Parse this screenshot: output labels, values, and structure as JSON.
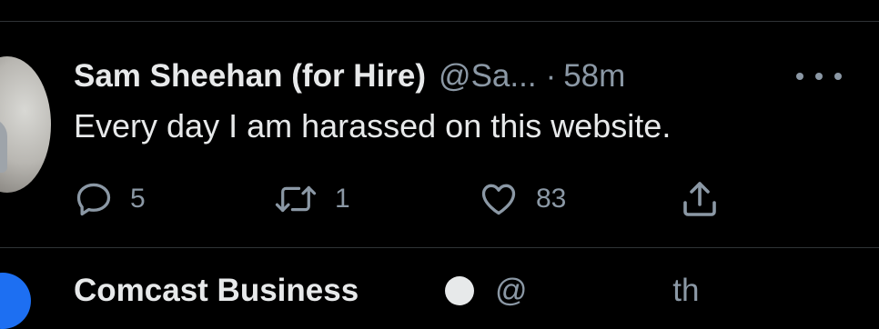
{
  "tweet": {
    "author_name": "Sam Sheehan (for Hire)",
    "author_handle": "@Sa...",
    "separator": "·",
    "time": "58m",
    "text": "Every day I am harassed on this website.",
    "actions": {
      "reply_count": "5",
      "retweet_count": "1",
      "like_count": "83"
    },
    "icons": {
      "reply": "reply-icon",
      "retweet": "retweet-icon",
      "like": "heart-icon",
      "share": "share-icon",
      "more": "more-icon"
    }
  },
  "next_tweet": {
    "author_name": "Comcast Business",
    "author_handle": "@",
    "time": "th"
  },
  "colors": {
    "background": "#000000",
    "primary_text": "#e7e9ea",
    "secondary_text": "#8b98a5",
    "divider": "#2f3336"
  }
}
